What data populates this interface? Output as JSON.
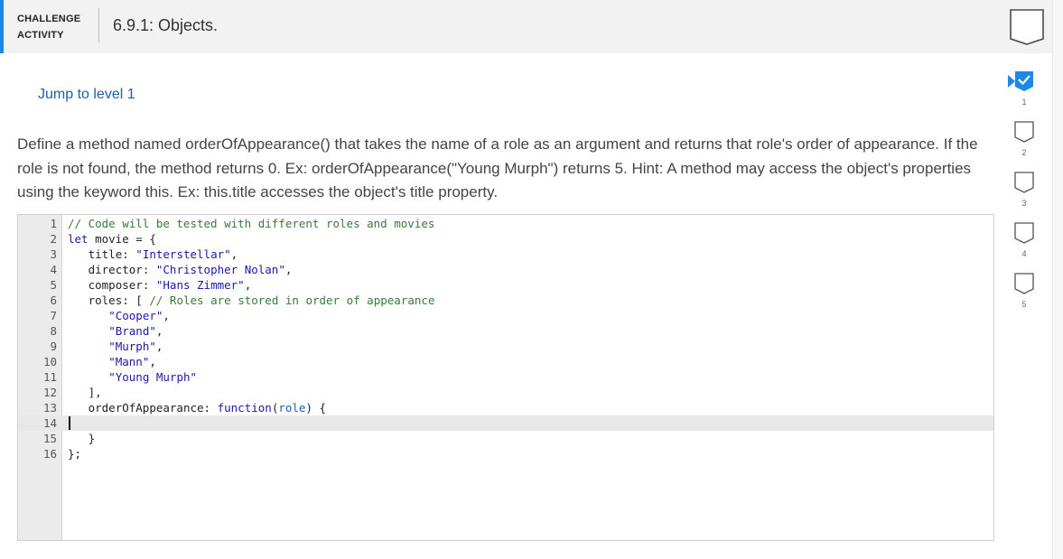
{
  "header": {
    "label_line1": "CHALLENGE",
    "label_line2": "ACTIVITY",
    "title": "6.9.1: Objects."
  },
  "jump_link": "Jump to level 1",
  "instructions": "Define a method named orderOfAppearance() that takes the name of a role as an argument and returns that role's order of appearance. If the role is not found, the method returns 0. Ex: orderOfAppearance(\"Young Murph\") returns 5. Hint: A method may access the object's properties using the keyword this. Ex: this.title accesses the object's title property.",
  "editor": {
    "active_line": 14,
    "lines": [
      {
        "n": "1",
        "text": "// Code will be tested with different roles and movies"
      },
      {
        "n": "2",
        "text": "let movie = {"
      },
      {
        "n": "3",
        "text": "   title: \"Interstellar\","
      },
      {
        "n": "4",
        "text": "   director: \"Christopher Nolan\","
      },
      {
        "n": "5",
        "text": "   composer: \"Hans Zimmer\","
      },
      {
        "n": "6",
        "text": "   roles: [ // Roles are stored in order of appearance"
      },
      {
        "n": "7",
        "text": "      \"Cooper\","
      },
      {
        "n": "8",
        "text": "      \"Brand\","
      },
      {
        "n": "9",
        "text": "      \"Murph\","
      },
      {
        "n": "10",
        "text": "      \"Mann\","
      },
      {
        "n": "11",
        "text": "      \"Young Murph\""
      },
      {
        "n": "12",
        "text": "   ],"
      },
      {
        "n": "13",
        "text": "   orderOfAppearance: function(role) {"
      },
      {
        "n": "14",
        "text": ""
      },
      {
        "n": "15",
        "text": "   }"
      },
      {
        "n": "16",
        "text": "};"
      }
    ]
  },
  "levels": [
    {
      "label": "1",
      "state": "current"
    },
    {
      "label": "2",
      "state": "incomplete"
    },
    {
      "label": "3",
      "state": "incomplete"
    },
    {
      "label": "4",
      "state": "incomplete"
    },
    {
      "label": "5",
      "state": "incomplete"
    }
  ],
  "colors": {
    "accent": "#1e88e5",
    "link": "#1e5fa8"
  },
  "icons": {
    "completion": "completion-chevron-icon",
    "level_current": "level-current-check-icon",
    "level_incomplete": "level-incomplete-chevron-icon"
  }
}
